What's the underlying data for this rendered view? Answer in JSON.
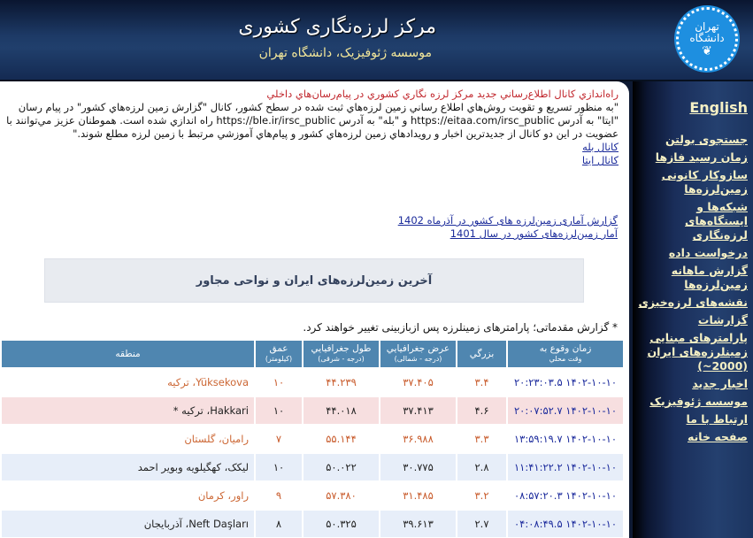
{
  "header": {
    "title": "مرکز لرزه‌نگاری کشوری",
    "subtitle": "موسسه ژئوفیزیک، دانشگاه تهران",
    "logo": {
      "line1": "تهران",
      "line2": "دانشگاه",
      "icon": "university-of-tehran-logo"
    }
  },
  "sidebar": {
    "english": "English",
    "items": [
      {
        "label": "جستجوی بولتن"
      },
      {
        "label": "زمان رسید فازها"
      },
      {
        "label": "سازوکار کانونی زمین‌لرزه‌ها"
      },
      {
        "label": "شبکه‌ها و ایستگاه‌های لرزه‌نگاری"
      },
      {
        "label": "درخواست داده"
      },
      {
        "label": "گزارش ماهانه زمین‌لرزه‌ها"
      },
      {
        "label": "نقشه‌های لرزه‌خیزی"
      },
      {
        "label": "گزارشات"
      },
      {
        "label": "پارامترهای مبنایی زمینلرزه‌های ایران (2000~)"
      },
      {
        "label": "اخبار جدید"
      },
      {
        "label": "موسسه ژئوفیزیک"
      },
      {
        "label": "ارتباط با ما"
      },
      {
        "label": "صفحه خانه"
      }
    ]
  },
  "news": {
    "title": "راه‌اندازي كانال اطلاع‌رساني جديد مركز لرزه نگاري كشوري در پيام‌رسان‌هاي داخلي",
    "body": "\"به منظور تسريع و تقويت روش‌هاي اطلاع رساني زمين لرزه‌هاي ثبت شده در سطح كشور، كانال \"گزارش زمين لرزه‌هاي كشور\" در پيام رسان \"ايتا\" به آدرس https://eitaa.com/irsc_public و \"بله\" به آدرس https://ble.ir/irsc_public راه اندازي شده است. هموطنان عزيز مي‌توانند با عضويت در اين دو كانال از جديدترين اخبار و رويدادهاي زمين لرزه‌هاي كشور و پيام‌هاي آموزشي مرتبط با زمين لرزه مطلع شوند.\"",
    "links": [
      {
        "label": "كانال بله"
      },
      {
        "label": "كانال ايتا"
      }
    ]
  },
  "reports": [
    {
      "label": "گزارش آماری زمین‌لرزه های کشور در آذرماه 1402"
    },
    {
      "label": "آمار زمین‌لرزه‌های کشور در سال 1401"
    }
  ],
  "section_title": "آخرین زمین‌لرزه‌های ایران و نواحی مجاور",
  "note": "* گزارش مقدماتی؛ پارامترهای زمینلرزه پس ازبازبینی تغییر خواهند کرد.",
  "table": {
    "headers": [
      {
        "main": "زمان وقوع به",
        "sub": "وقت محلي"
      },
      {
        "main": "بزرگي",
        "sub": ""
      },
      {
        "main": "عرض جغرافيايي",
        "sub": "(درجه - شمالی)"
      },
      {
        "main": "طول جغرافيايي",
        "sub": "(درجه - شرقی)"
      },
      {
        "main": "عمق",
        "sub": "(کیلومتر)"
      },
      {
        "main": "منطقه",
        "sub": ""
      }
    ],
    "rows": [
      {
        "time": "۱۴۰۲-۱۰-۱۰ ۲۰:۲۳:۰۳.۵",
        "mag": "۳.۴",
        "lat": "۳۷.۴۰۵",
        "lon": "۴۴.۲۳۹",
        "depth": "۱۰",
        "region": "Yüksekova، ترکیه",
        "style": "white",
        "color": "orange"
      },
      {
        "time": "۱۴۰۲-۱۰-۱۰ ۲۰:۰۷:۵۲.۷",
        "mag": "۴.۶",
        "lat": "۳۷.۴۱۳",
        "lon": "۴۴.۰۱۸",
        "depth": "۱۰",
        "region": "Hakkari، ترکیه *",
        "style": "pink",
        "color": "black"
      },
      {
        "time": "۱۴۰۲-۱۰-۱۰ ۱۳:۵۹:۱۹.۷",
        "mag": "۳.۳",
        "lat": "۳۶.۹۸۸",
        "lon": "۵۵.۱۴۴",
        "depth": "۷",
        "region": "رامیان، گلستان",
        "style": "white",
        "color": "orange"
      },
      {
        "time": "۱۴۰۲-۱۰-۱۰ ۱۱:۴۱:۲۲.۲",
        "mag": "۲.۸",
        "lat": "۳۰.۷۷۵",
        "lon": "۵۰.۰۲۲",
        "depth": "۱۰",
        "region": "لیکک، کهگیلویه وبویر احمد",
        "style": "blue",
        "color": "black"
      },
      {
        "time": "۱۴۰۲-۱۰-۱۰ ۰۸:۵۷:۲۰.۳",
        "mag": "۳.۲",
        "lat": "۳۱.۴۸۵",
        "lon": "۵۷.۳۸۰",
        "depth": "۹",
        "region": "راور، کرمان",
        "style": "white",
        "color": "orange"
      },
      {
        "time": "۱۴۰۲-۱۰-۱۰ ۰۴:۰۸:۴۹.۵",
        "mag": "۲.۷",
        "lat": "۳۹.۶۱۳",
        "lon": "۵۰.۳۲۵",
        "depth": "۸",
        "region": "Neft Daşları، آذربایجان",
        "style": "blue",
        "color": "black"
      }
    ]
  }
}
